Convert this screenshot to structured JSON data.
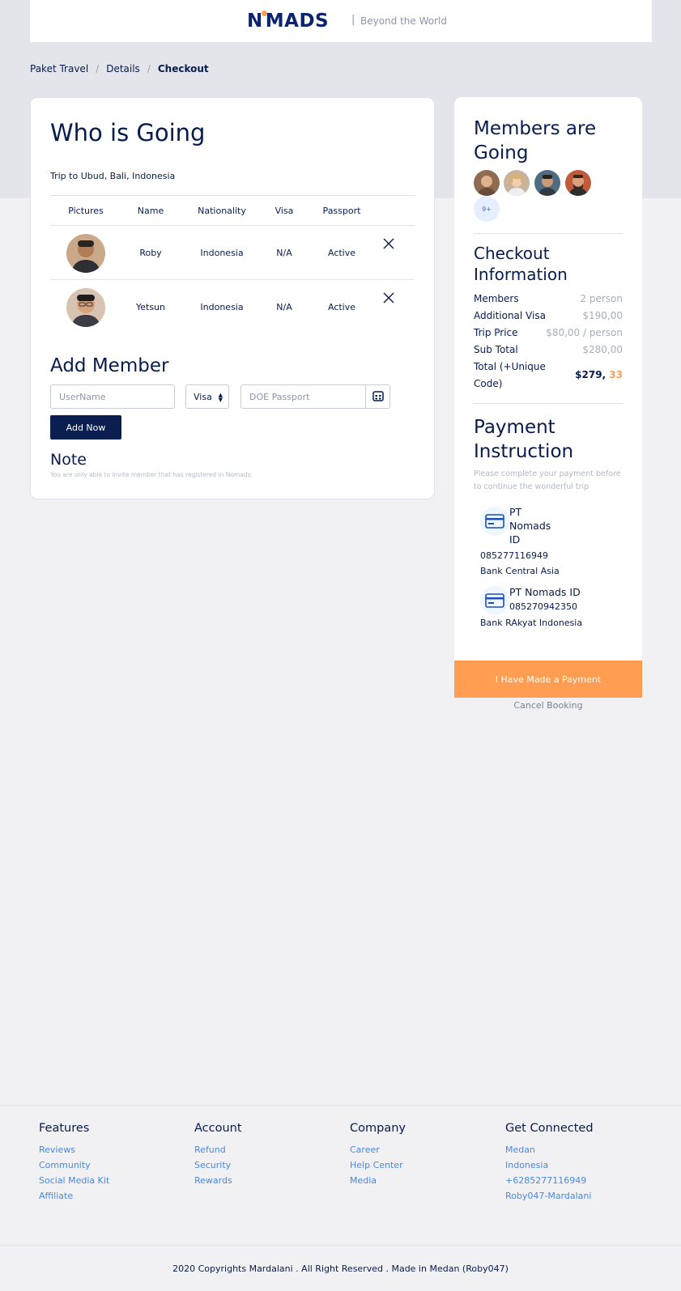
{
  "navbar": {
    "logo": "NOMADS",
    "logo_left": "N",
    "logo_right": "MADS",
    "separator": "|",
    "tagline": "Beyond the World"
  },
  "breadcrumb": {
    "items": [
      "Paket Travel",
      "Details",
      "Checkout"
    ],
    "separator": "/"
  },
  "who_is_going": {
    "title": "Who is Going",
    "trip": "Trip to Ubud, Bali, Indonesia",
    "columns": [
      "Pictures",
      "Name",
      "Nationality",
      "Visa",
      "Passport"
    ],
    "rows": [
      {
        "name": "Roby",
        "nationality": "Indonesia",
        "visa": "N/A",
        "passport": "Active"
      },
      {
        "name": "Yetsun",
        "nationality": "Indonesia",
        "visa": "N/A",
        "passport": "Active"
      }
    ]
  },
  "add_member": {
    "title": "Add Member",
    "username_placeholder": "UserName",
    "visa_value": "Visa",
    "doe_placeholder": "DOE Passport",
    "button": "Add Now"
  },
  "note": {
    "title": "Note",
    "text": "You are only able to invite member that has registered in Nomads."
  },
  "members_going": {
    "title": "Members are Going",
    "more": "9+"
  },
  "checkout_info": {
    "title": "Checkout Information",
    "rows": [
      {
        "label": "Members",
        "value": "2 person"
      },
      {
        "label": "Additional Visa",
        "value": "$190,00"
      },
      {
        "label": "Trip Price",
        "value": "$80,00 / person"
      },
      {
        "label": "Sub Total",
        "value": "$280,00"
      }
    ],
    "total_label": "Total (+Unique Code)",
    "total_value": "$279,",
    "total_code": "33"
  },
  "payment": {
    "title": "Payment Instruction",
    "subtitle": "Please complete your payment before to continue the wonderful trip",
    "banks": [
      {
        "name": "PT Nomads ID",
        "account": "085277116949",
        "bank": "Bank Central Asia"
      },
      {
        "name": "PT Nomads ID",
        "account": "085270942350",
        "bank": "Bank RAkyat Indonesia"
      }
    ],
    "pay_button": "I Have Made a Payment",
    "cancel": "Cancel Booking"
  },
  "footer": {
    "columns": [
      {
        "title": "Features",
        "links": [
          "Reviews",
          "Community",
          "Social Media Kit",
          "Affiliate"
        ]
      },
      {
        "title": "Account",
        "links": [
          "Refund",
          "Security",
          "Rewards"
        ]
      },
      {
        "title": "Company",
        "links": [
          "Career",
          "Help Center",
          "Media"
        ]
      },
      {
        "title": "Get Connected",
        "links": [
          "Medan",
          "Indonesia",
          "+6285277116949",
          "Roby047-Mardalani"
        ]
      }
    ],
    "copyright": "2020 Copyrights Mardalani . All Right Reserved . Made in Medan (Roby047)"
  },
  "colors": {
    "navy": "#071c4d",
    "accent": "#ff9e53",
    "link": "#4a88e0",
    "button_dark": "#0b1e50"
  },
  "icons": [
    "close-icon",
    "calendar-icon",
    "credit-card-icon",
    "sort-arrows-icon"
  ]
}
